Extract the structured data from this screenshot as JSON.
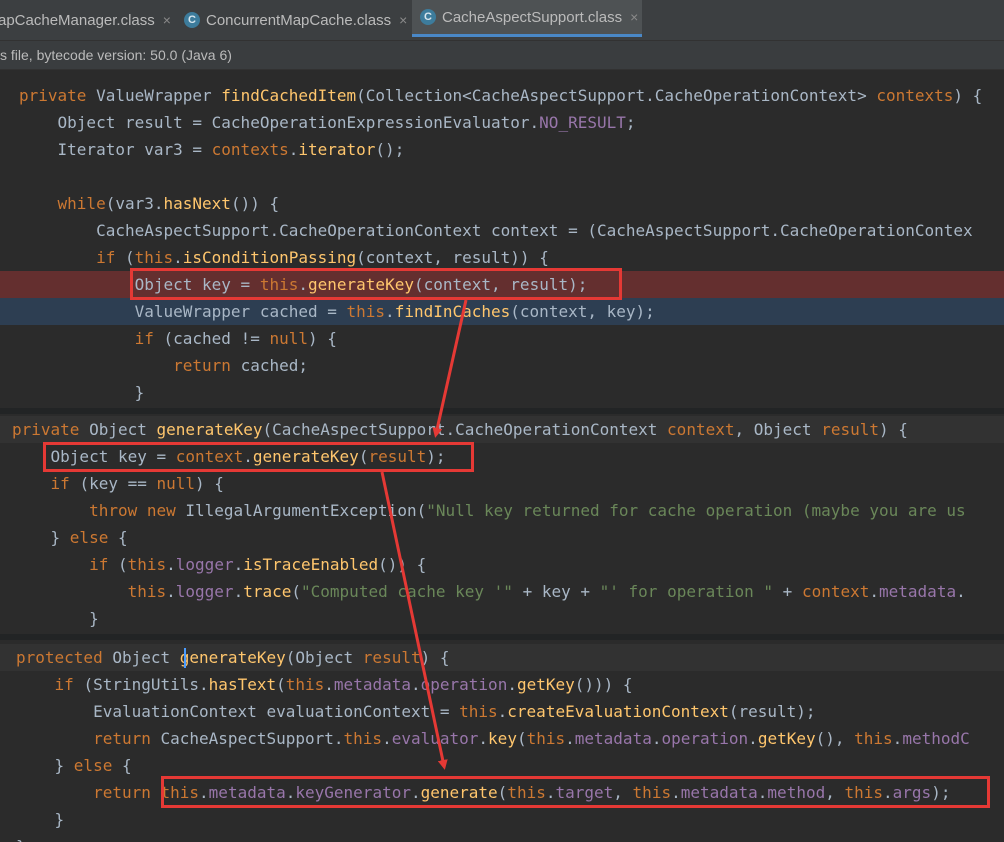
{
  "tabs": [
    {
      "label": "apCacheManager.class",
      "active": false,
      "icon": "class-file-icon"
    },
    {
      "label": "ConcurrentMapCache.class",
      "active": false,
      "icon": "class-file-icon"
    },
    {
      "label": "CacheAspectSupport.class",
      "active": true,
      "icon": "class-file-icon"
    }
  ],
  "tab_close": "×",
  "class_icon_letter": "C",
  "infobar": "s file, bytecode version: 50.0 (Java 6)",
  "colors": {
    "keyword": "#cc7832",
    "method": "#ffc66d",
    "field": "#9876aa",
    "string": "#6a8759",
    "text": "#a9b7c6",
    "breakpoint_line": "#642f2f",
    "execution_line": "#2d3e52",
    "annotation_box": "#e53935"
  },
  "code_panels": [
    {
      "name": "find-cached-item",
      "lines": [
        [
          [
            "k",
            "private "
          ],
          [
            "t",
            "ValueWrapper "
          ],
          [
            "m",
            "findCachedItem"
          ],
          [
            "t",
            "(Collection<CacheAspectSupport.CacheOperationContext> "
          ],
          [
            "k",
            "contexts"
          ],
          [
            "t",
            ") {"
          ]
        ],
        [
          [
            "t",
            "    Object result = CacheOperationExpressionEvaluator."
          ],
          [
            "p",
            "NO_RESULT"
          ],
          [
            "t",
            ";"
          ]
        ],
        [
          [
            "t",
            "    Iterator var3 = "
          ],
          [
            "k",
            "contexts"
          ],
          [
            "t",
            "."
          ],
          [
            "m",
            "iterator"
          ],
          [
            "t",
            "();"
          ]
        ],
        [
          [
            "t",
            ""
          ]
        ],
        [
          [
            "t",
            "    "
          ],
          [
            "k",
            "while"
          ],
          [
            "t",
            "(var3."
          ],
          [
            "m",
            "hasNext"
          ],
          [
            "t",
            "()) {"
          ]
        ],
        [
          [
            "t",
            "        CacheAspectSupport.CacheOperationContext context = (CacheAspectSupport.CacheOperationContex"
          ]
        ],
        [
          [
            "t",
            "        "
          ],
          [
            "k",
            "if "
          ],
          [
            "t",
            "("
          ],
          [
            "k",
            "this"
          ],
          [
            "t",
            "."
          ],
          [
            "m",
            "isConditionPassing"
          ],
          [
            "t",
            "(context, result)) {"
          ]
        ],
        [
          [
            "t",
            "            Object key = "
          ],
          [
            "k",
            "this"
          ],
          [
            "t",
            "."
          ],
          [
            "m",
            "generateKey"
          ],
          [
            "t",
            "(context, result);"
          ]
        ],
        [
          [
            "t",
            "            ValueWrapper cached = "
          ],
          [
            "k",
            "this"
          ],
          [
            "t",
            "."
          ],
          [
            "m",
            "findInCaches"
          ],
          [
            "t",
            "(context, key);"
          ]
        ],
        [
          [
            "t",
            "            "
          ],
          [
            "k",
            "if "
          ],
          [
            "t",
            "(cached != "
          ],
          [
            "k",
            "null"
          ],
          [
            "t",
            ") {"
          ]
        ],
        [
          [
            "t",
            "                "
          ],
          [
            "k",
            "return "
          ],
          [
            "t",
            "cached;"
          ]
        ],
        [
          [
            "t",
            "            }"
          ]
        ]
      ]
    },
    {
      "name": "generate-key-context",
      "lines": [
        [
          [
            "k",
            "private "
          ],
          [
            "t",
            "Object "
          ],
          [
            "m",
            "generateKey"
          ],
          [
            "t",
            "(CacheAspectSupport.CacheOperationContext "
          ],
          [
            "k",
            "context"
          ],
          [
            "t",
            ", Object "
          ],
          [
            "k",
            "result"
          ],
          [
            "t",
            ") {"
          ]
        ],
        [
          [
            "t",
            "    Object key = "
          ],
          [
            "k",
            "context"
          ],
          [
            "t",
            "."
          ],
          [
            "m",
            "generateKey"
          ],
          [
            "t",
            "("
          ],
          [
            "k",
            "result"
          ],
          [
            "t",
            ");"
          ]
        ],
        [
          [
            "t",
            "    "
          ],
          [
            "k",
            "if "
          ],
          [
            "t",
            "(key == "
          ],
          [
            "k",
            "null"
          ],
          [
            "t",
            ") {"
          ]
        ],
        [
          [
            "t",
            "        "
          ],
          [
            "k",
            "throw new "
          ],
          [
            "t",
            "IllegalArgumentException("
          ],
          [
            "s",
            "\"Null key returned for cache operation (maybe you are us"
          ]
        ],
        [
          [
            "t",
            "    } "
          ],
          [
            "k",
            "else "
          ],
          [
            "t",
            "{"
          ]
        ],
        [
          [
            "t",
            "        "
          ],
          [
            "k",
            "if "
          ],
          [
            "t",
            "("
          ],
          [
            "k",
            "this"
          ],
          [
            "t",
            "."
          ],
          [
            "p",
            "logger"
          ],
          [
            "t",
            "."
          ],
          [
            "m",
            "isTraceEnabled"
          ],
          [
            "t",
            "()) {"
          ]
        ],
        [
          [
            "t",
            "            "
          ],
          [
            "k",
            "this"
          ],
          [
            "t",
            "."
          ],
          [
            "p",
            "logger"
          ],
          [
            "t",
            "."
          ],
          [
            "m",
            "trace"
          ],
          [
            "t",
            "("
          ],
          [
            "s",
            "\"Computed cache key '\""
          ],
          [
            "t",
            " + key + "
          ],
          [
            "s",
            "\"' for operation \""
          ],
          [
            "t",
            " + "
          ],
          [
            "k",
            "context"
          ],
          [
            "t",
            "."
          ],
          [
            "p",
            "metadata"
          ],
          [
            "t",
            "."
          ]
        ],
        [
          [
            "t",
            "        }"
          ]
        ]
      ]
    },
    {
      "name": "generate-key-result",
      "lines": [
        [
          [
            "k",
            "protected "
          ],
          [
            "t",
            "Object "
          ],
          [
            "m",
            "generateKey"
          ],
          [
            "t",
            "(Object "
          ],
          [
            "k",
            "result"
          ],
          [
            "t",
            ") {"
          ]
        ],
        [
          [
            "t",
            "    "
          ],
          [
            "k",
            "if "
          ],
          [
            "t",
            "(StringUtils."
          ],
          [
            "m",
            "hasText"
          ],
          [
            "t",
            "("
          ],
          [
            "k",
            "this"
          ],
          [
            "t",
            "."
          ],
          [
            "p",
            "metadata"
          ],
          [
            "t",
            "."
          ],
          [
            "p",
            "operation"
          ],
          [
            "t",
            "."
          ],
          [
            "m",
            "getKey"
          ],
          [
            "t",
            "())) {"
          ]
        ],
        [
          [
            "t",
            "        EvaluationContext evaluationContext = "
          ],
          [
            "k",
            "this"
          ],
          [
            "t",
            "."
          ],
          [
            "m",
            "createEvaluationContext"
          ],
          [
            "t",
            "(result);"
          ]
        ],
        [
          [
            "t",
            "        "
          ],
          [
            "k",
            "return "
          ],
          [
            "t",
            "CacheAspectSupport."
          ],
          [
            "k",
            "this"
          ],
          [
            "t",
            "."
          ],
          [
            "p",
            "evaluator"
          ],
          [
            "t",
            "."
          ],
          [
            "m",
            "key"
          ],
          [
            "t",
            "("
          ],
          [
            "k",
            "this"
          ],
          [
            "t",
            "."
          ],
          [
            "p",
            "metadata"
          ],
          [
            "t",
            "."
          ],
          [
            "p",
            "operation"
          ],
          [
            "t",
            "."
          ],
          [
            "m",
            "getKey"
          ],
          [
            "t",
            "(), "
          ],
          [
            "k",
            "this"
          ],
          [
            "t",
            "."
          ],
          [
            "p",
            "methodC"
          ]
        ],
        [
          [
            "t",
            "    } "
          ],
          [
            "k",
            "else "
          ],
          [
            "t",
            "{"
          ]
        ],
        [
          [
            "t",
            "        "
          ],
          [
            "k",
            "return "
          ],
          [
            "k",
            "this"
          ],
          [
            "t",
            "."
          ],
          [
            "p",
            "metadata"
          ],
          [
            "t",
            "."
          ],
          [
            "p",
            "keyGenerator"
          ],
          [
            "t",
            "."
          ],
          [
            "m",
            "generate"
          ],
          [
            "t",
            "("
          ],
          [
            "k",
            "this"
          ],
          [
            "t",
            "."
          ],
          [
            "p",
            "target"
          ],
          [
            "t",
            ", "
          ],
          [
            "k",
            "this"
          ],
          [
            "t",
            "."
          ],
          [
            "p",
            "metadata"
          ],
          [
            "t",
            "."
          ],
          [
            "p",
            "method"
          ],
          [
            "t",
            ", "
          ],
          [
            "k",
            "this"
          ],
          [
            "t",
            "."
          ],
          [
            "p",
            "args"
          ],
          [
            "t",
            ");"
          ]
        ],
        [
          [
            "t",
            "    }"
          ]
        ],
        [
          [
            "t",
            "}"
          ]
        ]
      ]
    }
  ]
}
